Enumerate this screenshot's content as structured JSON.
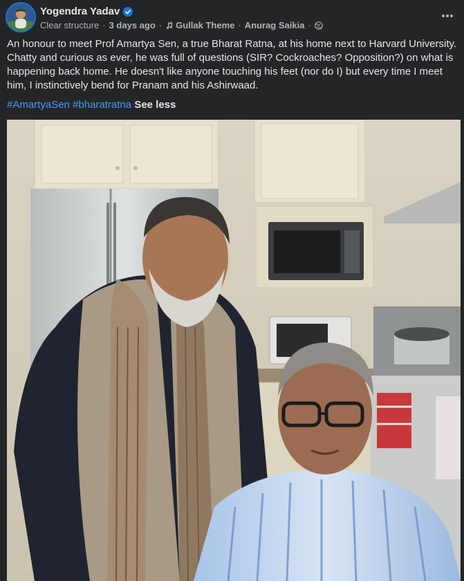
{
  "post": {
    "author": "Yogendra Yadav",
    "verified_icon": "verified-badge-icon",
    "meta": {
      "group": "Clear structure",
      "time": "3 days ago",
      "music_icon": "music-note-icon",
      "song": "Gullak Theme",
      "artist": "Anurag Saikia",
      "privacy_icon": "globe-icon"
    },
    "text": "An honour to meet Prof Amartya Sen, a true Bharat Ratna, at his home next to Harvard University. Chatty and curious as ever, he was full of questions (SIR? Cockroaches? Opposition?) on what is happening back home. He doesn't like anyone touching his feet (nor do I) but every time I meet him, I instinctively bend for Pranam and his Ashirwaad.",
    "hashtags": [
      "#AmartyaSen",
      "#bharatratna"
    ],
    "see_less": "See less",
    "more_icon": "more-options-icon"
  },
  "colors": {
    "background": "#242526",
    "text": "#e4e6eb",
    "secondary": "#b0b3b8",
    "link": "#4599ff",
    "verified": "#1b74e4"
  }
}
